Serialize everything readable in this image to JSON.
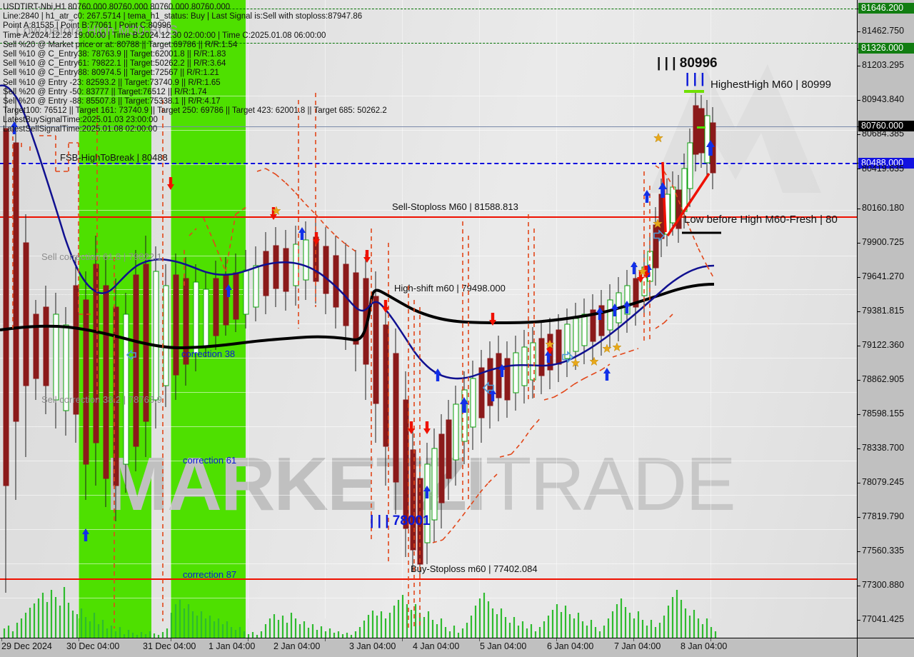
{
  "chart_data": {
    "type": "line",
    "title": "USDTIRT-Nbi,H1  80760.000 80760.000 80760.000 80760.000",
    "symbol": "USDTIRT-Nbi",
    "timeframe": "H1",
    "ohlc": {
      "open": "80760.000",
      "high": "80760.000",
      "low": "80760.000",
      "close": "80760.000"
    },
    "xlabel": "",
    "ylabel": "",
    "ylim": [
      76900,
      81720
    ],
    "xlim": [
      "29 Dec 2024",
      "8 Jan 04:00"
    ],
    "grid": true,
    "legend": "none",
    "y_ticks": [
      "81646.200",
      "81462.750",
      "81326.000",
      "81203.295",
      "80943.840",
      "80760.000",
      "80684.385",
      "80488.000",
      "80419.635",
      "80160.180",
      "79900.725",
      "79641.270",
      "79381.815",
      "79122.360",
      "78862.905",
      "78598.155",
      "78338.700",
      "78079.245",
      "77819.790",
      "77560.335",
      "77300.880",
      "77041.425"
    ],
    "x_ticks": [
      "29 Dec 2024",
      "30 Dec 04:00",
      "31 Dec 04:00",
      "1 Jan 04:00",
      "2 Jan 04:00",
      "3 Jan 04:00",
      "4 Jan 04:00",
      "5 Jan 04:00",
      "6 Jan 04:00",
      "7 Jan 04:00",
      "8 Jan 04:00"
    ],
    "price_badges": [
      {
        "value": "81646.200",
        "color": "#117d11"
      },
      {
        "value": "81326.000",
        "color": "#117d11"
      },
      {
        "value": "80760.000",
        "color": "#000000"
      },
      {
        "value": "80488.000",
        "color": "#1212e0"
      }
    ],
    "levels": [
      {
        "label": "Sell-Stoploss M60 | 81588.813",
        "value": 81588.813,
        "color": "#ef1000"
      },
      {
        "label": "FSB-HighToBreak | 80488",
        "value": 80488,
        "color": "#0000dd"
      },
      {
        "label": "High-shift m60 | 79498.000",
        "value": 79498.0,
        "color": "#ffffff"
      },
      {
        "label": "Buy-Stoploss m60 | 77402.084",
        "value": 77402.084,
        "color": "#ef1000"
      }
    ],
    "annotations": [
      {
        "text": "| | | 80996",
        "color": "#101010"
      },
      {
        "text": "| | |",
        "color": "#0a18d8"
      },
      {
        "text": "HighestHigh   M60 | 80999",
        "color": "#101010"
      },
      {
        "text": "Low before High   M60-Fresh | 80",
        "color": "#101010"
      },
      {
        "text": "| | | 78001",
        "color": "#0a18d8"
      },
      {
        "text": "Sell correction 61.8 | 79822.1",
        "color": "#8d8d8d"
      },
      {
        "text": "Sell correction 38.2 | 78763.9",
        "color": "#8d8d8d"
      },
      {
        "text": "correction 38",
        "color": "#0a18d8"
      },
      {
        "text": "correction 61",
        "color": "#0a18d8"
      },
      {
        "text": "correction 87",
        "color": "#0a18d8"
      },
      {
        "text": "Low before High   M30-BOS",
        "color": "#9a9a9a"
      }
    ],
    "indicators": [
      "TEMA (blue)",
      "EMA (black)",
      "Parabolic SAR (orange dashed)",
      "Volume (green)"
    ],
    "watermark": {
      "bold": "MARKETZ",
      "separator": "I",
      "light": "TRADE"
    }
  },
  "header": {
    "lines": [
      "USDTIRT-Nbi,H1  80760.000 80760.000 80760.000 80760.000",
      "Line:2840 | h1_atr_c0: 267.5714 | tema_h1_status: Buy | Last Signal is:Sell with stoploss:87947.86",
      "Point A:81535 | Point B:77061 | Point C:80996",
      "Time A:2024.12.28 19:00:00 | Time B:2024.12.30 02:00:00 | Time C:2025.01.08 06:00:00",
      "Sell %20 @ Market price or at: 80788 || Target:69786 || R/R:1.54",
      "Sell %10 @ C_Entry38: 78763.9 || Target:62001.8 || R/R:1.83",
      "Sell %10 @ C_Entry61: 79822.1 || Target:50262.2 || R/R:3.64",
      "Sell %10 @ C_Entry88: 80974.5 || Target:72567 || R/R:1.21",
      "Sell %10 @ Entry -23: 82593.2 || Target:73740.9 || R/R:1.65",
      "Sell %20 @ Entry -50: 83777 || Target:76512 || R/R:1.74",
      "Sell %20 @ Entry -88: 85507.8 || Target:75338.1 || R/R:4.17",
      "Target100: 76512 || Target 161: 73740.9 || Target 250: 69786 || Target 423: 62001.8 || Target 685: 50262.2",
      "LatestBuySignalTime:2025.01.03 23:00:00",
      "LatestSellSignalTime:2025.01.08 02:00:00"
    ],
    "ghost_overlay": "Low before High   M30-BOS"
  },
  "labels": {
    "sell_stoploss": "Sell-Stoploss M60 | 81588.813",
    "buy_stoploss": "Buy-Stoploss m60 | 77402.084",
    "fsb_high_to_break": "FSB-HighToBreak | 80488",
    "high_shift": "High-shift m60 | 79498.000",
    "point_c_black": "| | | 80996",
    "point_c_blue_bars": "| | |",
    "highest_high": "HighestHigh   M60 | 80999",
    "low_before_high": "Low before High   M60-Fresh | 80",
    "point_b_blue": "| | | 78001",
    "sell_corr_618": "Sell correction 61.8 | 79822.1",
    "sell_corr_382": "Sell correction 38.2 | 78763.9",
    "corr_38": "correction 38",
    "corr_61": "correction 61",
    "corr_87": "correction 87"
  },
  "colors": {
    "bull_candle": "#0aa00a",
    "bear_candle": "#8b1a1a",
    "sar": "#e2471a",
    "tema": "#101090",
    "ema": "#000000",
    "volume": "#2fbb2f",
    "session_green": "#4ee000",
    "session_orange": "#e09a63",
    "stoploss_red": "#ef1000",
    "level_blue": "#1212e0",
    "badge_green": "#117d11",
    "badge_black": "#000000"
  },
  "watermark": {
    "bold": "MARKETZ",
    "sep": "I",
    "light": "TRADE"
  }
}
